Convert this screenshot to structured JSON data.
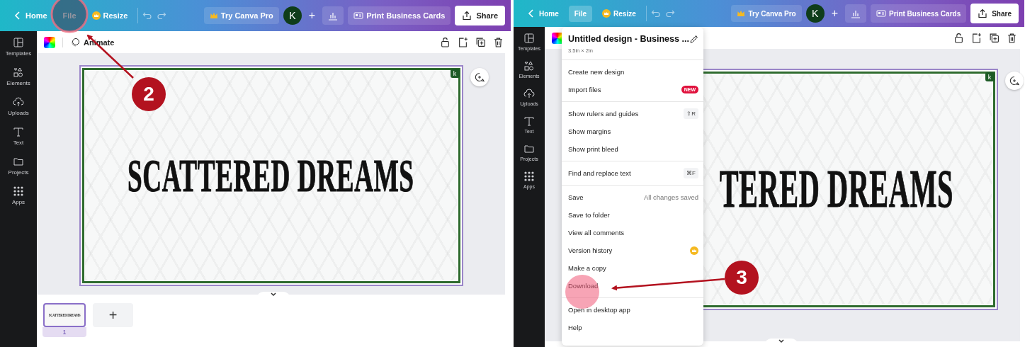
{
  "panels": [
    {
      "top_bar": {
        "home": "Home",
        "file": {
          "label": "File",
          "selected": false
        },
        "resize": "Resize",
        "pro": "Try Canva Pro",
        "avatar": "K",
        "add": "+",
        "print": "Print Business Cards",
        "share": "Share"
      },
      "sidebar": {
        "items": [
          "Templates",
          "Elements",
          "Uploads",
          "Text",
          "Projects",
          "Apps"
        ]
      },
      "toolbar": {
        "animate": "Animate"
      },
      "design": {
        "text": "SCATTERED DREAMS",
        "badge": "k"
      },
      "pages": {
        "thumbnails": [
          {
            "text": "SCATTERED DREAMS",
            "number": "1",
            "selected": true
          }
        ],
        "add": "+"
      },
      "annotation": {
        "step": "2"
      }
    },
    {
      "top_bar": {
        "home": "Home",
        "file": {
          "label": "File",
          "selected": true
        },
        "resize": "Resize",
        "pro": "Try Canva Pro",
        "avatar": "K",
        "add": "+",
        "print": "Print Business Cards",
        "share": "Share"
      },
      "sidebar": {
        "items": [
          "Templates",
          "Elements",
          "Uploads",
          "Text",
          "Projects",
          "Apps"
        ]
      },
      "design": {
        "text": "TERED DREAMS",
        "badge": "k"
      },
      "file_menu": {
        "title": "Untitled design - Business ...",
        "size": "3.5in × 2in",
        "sections": [
          {
            "items": [
              {
                "label": "Create new design",
                "premium": false
              },
              {
                "label": "Import files",
                "badge": "NEW",
                "premium": false
              }
            ]
          },
          {
            "items": [
              {
                "label": "Show rulers and guides",
                "shortcut": "⇧R",
                "premium": false
              },
              {
                "label": "Show margins",
                "premium": false
              },
              {
                "label": "Show print bleed",
                "premium": false
              }
            ]
          },
          {
            "items": [
              {
                "label": "Find and replace text",
                "shortcut": "⌘F",
                "premium": false
              }
            ]
          },
          {
            "items": [
              {
                "label": "Save",
                "status": "All changes saved",
                "premium": false
              },
              {
                "label": "Save to folder",
                "premium": false
              },
              {
                "label": "View all comments",
                "premium": false
              },
              {
                "label": "Version history",
                "premium": true
              },
              {
                "label": "Make a copy",
                "premium": false
              },
              {
                "label": "Download",
                "premium": false
              }
            ]
          },
          {
            "items": [
              {
                "label": "Open in desktop app",
                "premium": false
              },
              {
                "label": "Help",
                "premium": false
              }
            ]
          }
        ]
      },
      "annotation": {
        "step": "3"
      }
    }
  ]
}
